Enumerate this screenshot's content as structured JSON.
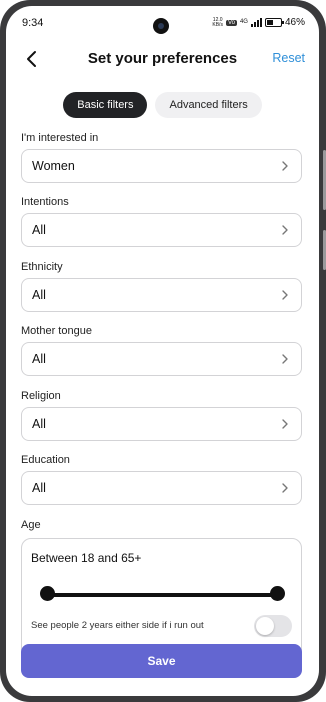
{
  "status_bar": {
    "time": "9:34",
    "net_speed_value": "12.0",
    "net_speed_unit": "KB/s",
    "badge": "Vo",
    "network": "4G",
    "battery": "46%"
  },
  "header": {
    "title": "Set your preferences",
    "reset_label": "Reset",
    "back_icon": "back-arrow-icon"
  },
  "tabs": [
    {
      "label": "Basic filters",
      "active": true
    },
    {
      "label": "Advanced filters",
      "active": false
    }
  ],
  "fields": [
    {
      "label": "I'm interested in",
      "value": "Women"
    },
    {
      "label": "Intentions",
      "value": "All"
    },
    {
      "label": "Ethnicity",
      "value": "All"
    },
    {
      "label": "Mother tongue",
      "value": "All"
    },
    {
      "label": "Religion",
      "value": "All"
    },
    {
      "label": "Education",
      "value": "All"
    }
  ],
  "age": {
    "label": "Age",
    "range_text": "Between 18 and 65+",
    "expand_text": "See people 2 years either side if i run out",
    "expand_enabled": false
  },
  "save_label": "Save",
  "colors": {
    "accent": "#6366d1",
    "link": "#2f8fd8",
    "active_tab": "#222326"
  }
}
